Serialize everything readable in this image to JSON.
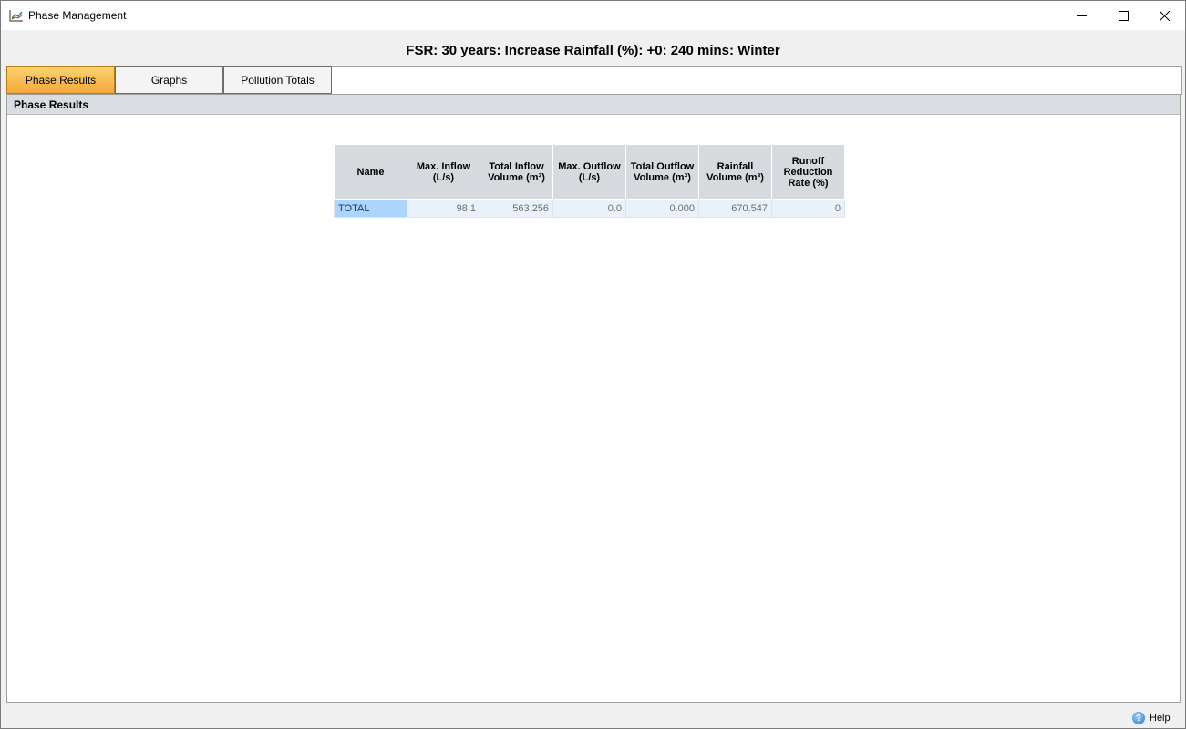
{
  "window": {
    "title": "Phase Management",
    "controls": {
      "minimize": "minimize",
      "maximize": "maximize",
      "close": "close"
    }
  },
  "header": {
    "caption": "FSR: 30 years: Increase Rainfall (%): +0: 240 mins: Winter"
  },
  "tabs": [
    {
      "label": "Phase Results",
      "active": true
    },
    {
      "label": "Graphs",
      "active": false
    },
    {
      "label": "Pollution Totals",
      "active": false
    }
  ],
  "section": {
    "title": "Phase Results"
  },
  "table": {
    "columns": [
      "Name",
      "Max. Inflow (L/s)",
      "Total Inflow Volume (m³)",
      "Max. Outflow (L/s)",
      "Total Outflow Volume (m³)",
      "Rainfall Volume (m³)",
      "Runoff Reduction Rate (%)"
    ],
    "rows": [
      [
        "TOTAL",
        "98.1",
        "563.256",
        "0.0",
        "0.000",
        "670.547",
        "0"
      ]
    ]
  },
  "footer": {
    "help_label": "Help"
  },
  "colors": {
    "active_tab": "#f4a93c",
    "header_gray": "#d6d9dd",
    "selected_cell": "#abd4ff",
    "row_bg": "#e9f2fb"
  }
}
